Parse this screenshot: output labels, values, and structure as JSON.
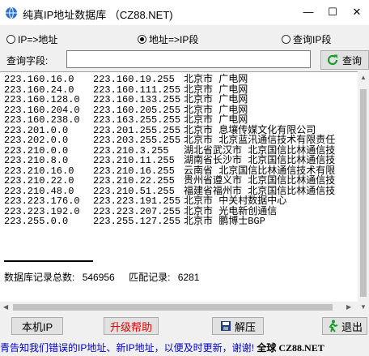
{
  "window": {
    "title": "纯真IP地址数据库 （CZ88.NET)",
    "minimize": "—",
    "maximize": "☐",
    "close": "✕"
  },
  "radios": [
    {
      "label": "IP=>地址",
      "selected": false
    },
    {
      "label": "地址=>IP段",
      "selected": true
    },
    {
      "label": "查询IP段",
      "selected": false
    }
  ],
  "query": {
    "label": "查询字段:",
    "value": "",
    "button": "查询"
  },
  "results": [
    {
      "start": "223.160.16.0",
      "end": "223.160.19.255",
      "location": "北京市 广电网"
    },
    {
      "start": "223.160.24.0",
      "end": "223.160.111.255",
      "location": "北京市 广电网"
    },
    {
      "start": "223.160.128.0",
      "end": "223.160.133.255",
      "location": "北京市 广电网"
    },
    {
      "start": "223.160.204.0",
      "end": "223.160.205.255",
      "location": "北京市 广电网"
    },
    {
      "start": "223.160.238.0",
      "end": "223.163.255.255",
      "location": "北京市 广电网"
    },
    {
      "start": "223.201.0.0",
      "end": "223.201.255.255",
      "location": "北京市 息壤传媒文化有限公司"
    },
    {
      "start": "223.202.0.0",
      "end": "223.203.255.255",
      "location": "北京市 北京蓝汛通信技术有限责任"
    },
    {
      "start": "223.210.0.0",
      "end": "223.210.3.255",
      "location": "湖北省武汉市 北京国信比林通信技"
    },
    {
      "start": "223.210.8.0",
      "end": "223.210.11.255",
      "location": "湖南省长沙市 北京国信比林通信技"
    },
    {
      "start": "223.210.16.0",
      "end": "223.210.16.255",
      "location": "云南省 北京国信比林通信技术有限"
    },
    {
      "start": "223.210.22.0",
      "end": "223.210.22.255",
      "location": "贵州省遵义市 北京国信比林通信技"
    },
    {
      "start": "223.210.48.0",
      "end": "223.210.51.255",
      "location": "福建省福州市 北京国信比林通信技"
    },
    {
      "start": "223.223.176.0",
      "end": "223.223.191.255",
      "location": "北京市 中关村数据中心"
    },
    {
      "start": "223.223.192.0",
      "end": "223.223.207.255",
      "location": "北京市 光电新创通信"
    },
    {
      "start": "223.255.0.0",
      "end": "223.255.127.255",
      "location": "北京市 鹏博士BGP"
    }
  ],
  "stats": {
    "label_total": "数据库记录总数:",
    "total": "546956",
    "label_match": "匹配记录:",
    "match": "6281"
  },
  "toolbar": {
    "local_ip": "本机IP",
    "upgrade": "升级帮助",
    "extract": "解压",
    "exit": "退出"
  },
  "marquee": {
    "text": "青告知我们错误的IP地址、新IP地址，以便及时更新，谢谢!",
    "brand": "全球 CZ88.NET"
  },
  "colors": {
    "upgrade_text": "#e00000",
    "marquee_text": "#0000cc",
    "query_icon": "#1a9e2a",
    "exit_icon": "#1a9e2a"
  }
}
